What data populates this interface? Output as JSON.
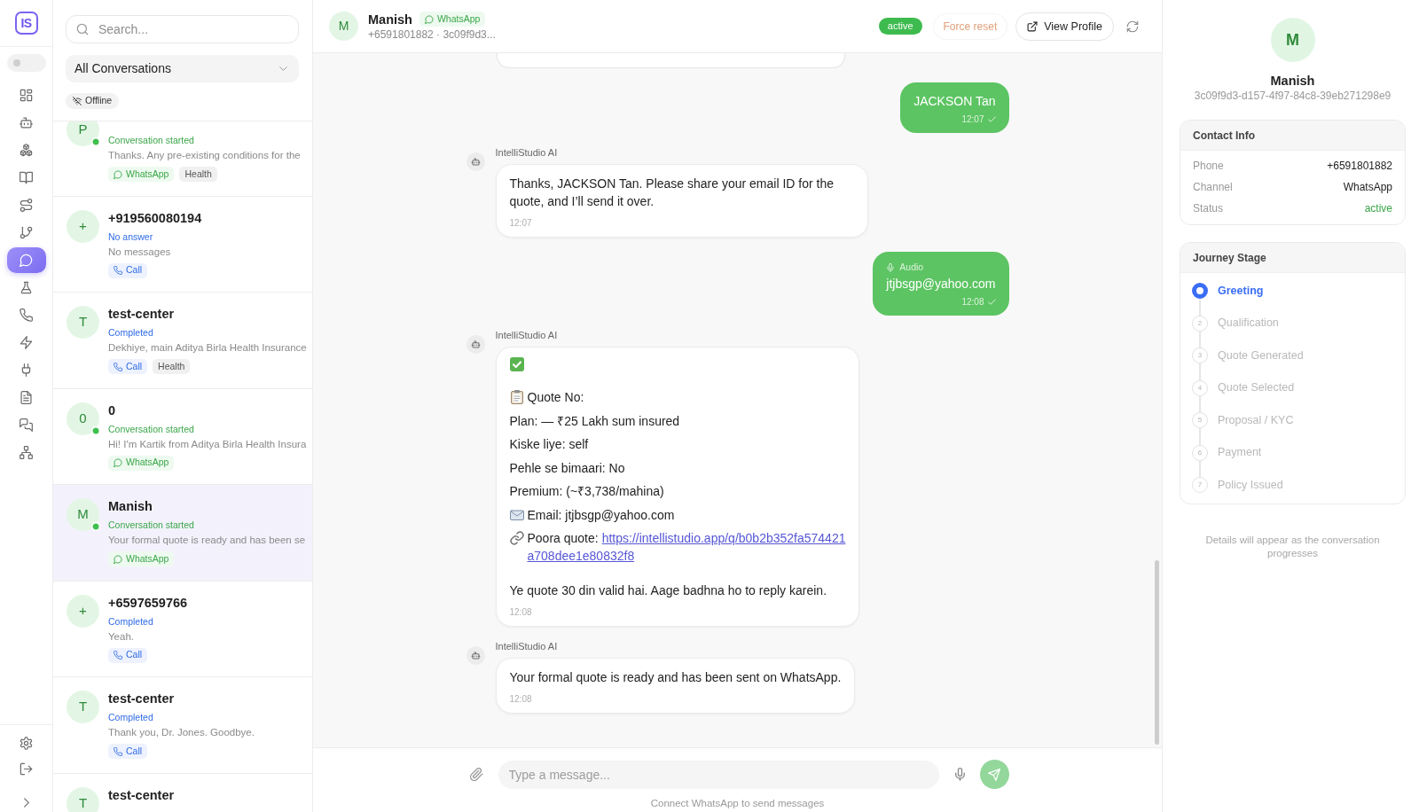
{
  "nav": {
    "logo": "IS",
    "toggle": {
      "on": false
    },
    "items": [
      {
        "selected": false
      },
      {
        "selected": false
      },
      {
        "selected": false
      },
      {
        "selected": false
      },
      {
        "selected": false
      },
      {
        "selected": false
      },
      {
        "selected": true
      },
      {
        "selected": false
      },
      {
        "selected": false
      },
      {
        "selected": false
      },
      {
        "selected": false
      },
      {
        "selected": false
      },
      {
        "selected": false
      },
      {
        "selected": false
      }
    ]
  },
  "conversations": {
    "search": {
      "placeholder": "Search..."
    },
    "filter": {
      "value": "All Conversations"
    },
    "connection": {
      "label": "Offline"
    },
    "items": [
      {
        "avatar": "P",
        "online": true,
        "selected": false,
        "status": {
          "text": "Conversation started",
          "color": "#3aa648"
        },
        "preview": "Thanks. Any pre-existing conditions for the",
        "tags": [
          {
            "kind": "whatsapp",
            "label": "WhatsApp"
          },
          {
            "kind": "topic",
            "label": "Health"
          }
        ]
      },
      {
        "avatar": "+",
        "name": "+919560080194",
        "online": false,
        "selected": false,
        "status": {
          "text": "No answer",
          "color": "#2f6be5"
        },
        "preview": "No messages",
        "tags": [
          {
            "kind": "call",
            "label": "Call"
          }
        ]
      },
      {
        "avatar": "T",
        "name": "test-center",
        "online": false,
        "selected": false,
        "status": {
          "text": "Completed",
          "color": "#2f6be5"
        },
        "preview": "Dekhiye, main Aditya Birla Health Insurance",
        "tags": [
          {
            "kind": "call",
            "label": "Call"
          },
          {
            "kind": "topic",
            "label": "Health"
          }
        ]
      },
      {
        "avatar": "0",
        "name": "0",
        "online": true,
        "selected": false,
        "status": {
          "text": "Conversation started",
          "color": "#3aa648"
        },
        "preview": "Hi! I'm Kartik from Aditya Birla Health Insura",
        "tags": [
          {
            "kind": "whatsapp",
            "label": "WhatsApp"
          }
        ]
      },
      {
        "avatar": "M",
        "name": "Manish",
        "online": true,
        "selected": true,
        "status": {
          "text": "Conversation started",
          "color": "#3aa648"
        },
        "preview": "Your formal quote is ready and has been se",
        "tags": [
          {
            "kind": "whatsapp",
            "label": "WhatsApp"
          }
        ]
      },
      {
        "avatar": "+",
        "name": "+6597659766",
        "online": false,
        "selected": false,
        "status": {
          "text": "Completed",
          "color": "#2f6be5"
        },
        "preview": "Yeah.",
        "tags": [
          {
            "kind": "call",
            "label": "Call"
          }
        ]
      },
      {
        "avatar": "T",
        "name": "test-center",
        "online": false,
        "selected": false,
        "status": {
          "text": "Completed",
          "color": "#2f6be5"
        },
        "preview": "Thank you, Dr. Jones. Goodbye.",
        "tags": [
          {
            "kind": "call",
            "label": "Call"
          }
        ]
      },
      {
        "avatar": "T",
        "name": "test-center",
        "online": false,
        "selected": false
      }
    ]
  },
  "chat": {
    "header": {
      "avatar": "M",
      "name": "Manish",
      "channel": {
        "kind": "whatsapp",
        "label": "WhatsApp"
      },
      "subtitle": "+6591801882 · 3c09f9d3...",
      "status": "active",
      "actions": [
        {
          "kind": "warning",
          "label": "Force reset"
        },
        {
          "kind": "outline",
          "label": "View Profile"
        },
        {
          "kind": "refresh"
        }
      ]
    },
    "messages": [
      {
        "kind": "partial"
      },
      {
        "kind": "outgoing",
        "text": "JACKSON Tan",
        "time": "12:07",
        "sent": true
      },
      {
        "kind": "incoming",
        "sender": "IntelliStudio AI",
        "text": "Thanks, JACKSON Tan. Please share your email ID for the quote, and I’ll send it over.",
        "time": "12:07"
      },
      {
        "kind": "outgoing",
        "attachment": "Audio",
        "text": "jtjbsgp@yahoo.com",
        "time": "12:08",
        "sent": true
      },
      {
        "kind": "incoming",
        "sender": "IntelliStudio AI",
        "lines": [
          {
            "kind": "tick"
          },
          {
            "kind": "gap"
          },
          {
            "kind": "clipboard",
            "text": "Quote No:"
          },
          {
            "kind": "plain",
            "text": "Plan: — ₹25 Lakh sum insured"
          },
          {
            "kind": "plain",
            "text": "Kiske liye: self"
          },
          {
            "kind": "plain",
            "text": "Pehle se bimaari: No"
          },
          {
            "kind": "plain",
            "text": "Premium: (~₹3,738/mahina)"
          },
          {
            "kind": "envelope",
            "text": "Email: jtjbsgp@yahoo.com"
          },
          {
            "kind": "link",
            "text": "Poora quote:",
            "link": [
              "https://intellistudio.app/q/b0b2b352fa574421",
              "a708dee1e80832f8"
            ]
          },
          {
            "kind": "gap"
          },
          {
            "kind": "plain",
            "text": "Ye quote 30 din valid hai. Aage badhna ho to reply karein."
          }
        ],
        "time": "12:08"
      },
      {
        "kind": "incoming",
        "sender": "IntelliStudio AI",
        "text": "Your formal quote is ready and has been sent on WhatsApp.",
        "time": "12:08"
      }
    ],
    "composer": {
      "placeholder": "Type a message...",
      "send_button": {
        "disabled": true
      },
      "note": "Connect WhatsApp to send messages"
    }
  },
  "profile": {
    "avatar": "M",
    "name": "Manish",
    "id": "3c09f9d3-d157-4f97-84c8-39eb271298e9",
    "contact_info": {
      "title": "Contact Info",
      "rows": [
        {
          "label": "Phone",
          "value": "+6591801882"
        },
        {
          "label": "Channel",
          "value": "WhatsApp"
        },
        {
          "label": "Status",
          "value": "active",
          "color": "#3aa648"
        }
      ]
    },
    "journey": {
      "title": "Journey Stage",
      "steps": [
        {
          "label": "Greeting",
          "selected": true
        },
        {
          "number": "2",
          "label": "Qualification",
          "selected": false
        },
        {
          "number": "3",
          "label": "Quote Generated",
          "selected": false
        },
        {
          "number": "4",
          "label": "Quote Selected",
          "selected": false
        },
        {
          "number": "5",
          "label": "Proposal / KYC",
          "selected": false
        },
        {
          "number": "6",
          "label": "Payment",
          "selected": false
        },
        {
          "number": "7",
          "label": "Policy Issued",
          "selected": false
        }
      ]
    },
    "footer": "Details will appear as the conversation progresses"
  }
}
